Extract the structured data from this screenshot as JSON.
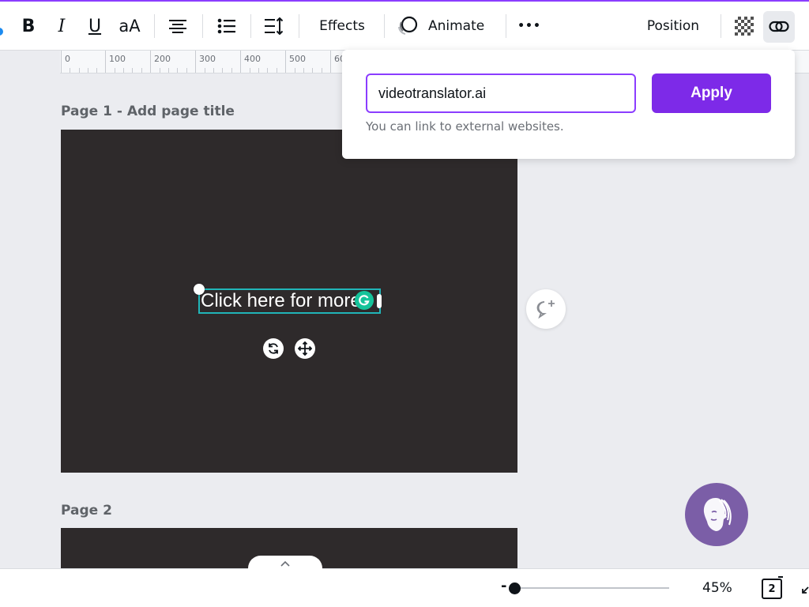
{
  "toolbar": {
    "bold_label": "B",
    "italic_label": "I",
    "underline_label": "U",
    "case_label": "aA",
    "effects_label": "Effects",
    "animate_label": "Animate",
    "more_label": "•••",
    "position_label": "Position"
  },
  "ruler": {
    "labels": [
      "0",
      "100",
      "200",
      "300",
      "400",
      "500",
      "60"
    ]
  },
  "pages": [
    {
      "title": "Page 1 - Add page title",
      "text": "Click here for more"
    },
    {
      "title": "Page 2"
    }
  ],
  "link_popover": {
    "input_value": "videotranslator.ai",
    "apply_label": "Apply",
    "hint": "You can link to external websites."
  },
  "bottom_bar": {
    "zoom_minus": "-",
    "zoom_label": "45%",
    "page_count": "2"
  },
  "colors": {
    "accent": "#7d2ae8",
    "page_bg": "#2e2a2b",
    "selection": "#21b5b8",
    "grammarly": "#15c39a",
    "assistant": "#7b5ea7"
  },
  "icons": [
    "align-center-icon",
    "bullet-list-icon",
    "line-spacing-icon",
    "animate-icon",
    "transparency-icon",
    "link-icon",
    "rotate-icon",
    "move-icon",
    "add-comment-icon",
    "chevron-up-icon",
    "assistant-avatar-icon",
    "page-grid-icon",
    "expand-icon"
  ]
}
